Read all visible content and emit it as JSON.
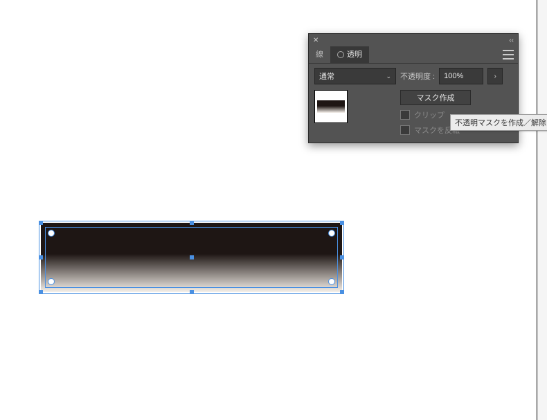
{
  "panel": {
    "tabs": {
      "stroke": "線",
      "transparency": "透明"
    },
    "blend_mode": {
      "value": "通常"
    },
    "opacity": {
      "label": "不透明度 :",
      "value": "100%"
    },
    "make_mask_button": "マスク作成",
    "clip_checkbox": "クリップ",
    "invert_mask_checkbox": "マスクを反転"
  },
  "tooltip": {
    "text": "不透明マスクを作成／解除"
  }
}
